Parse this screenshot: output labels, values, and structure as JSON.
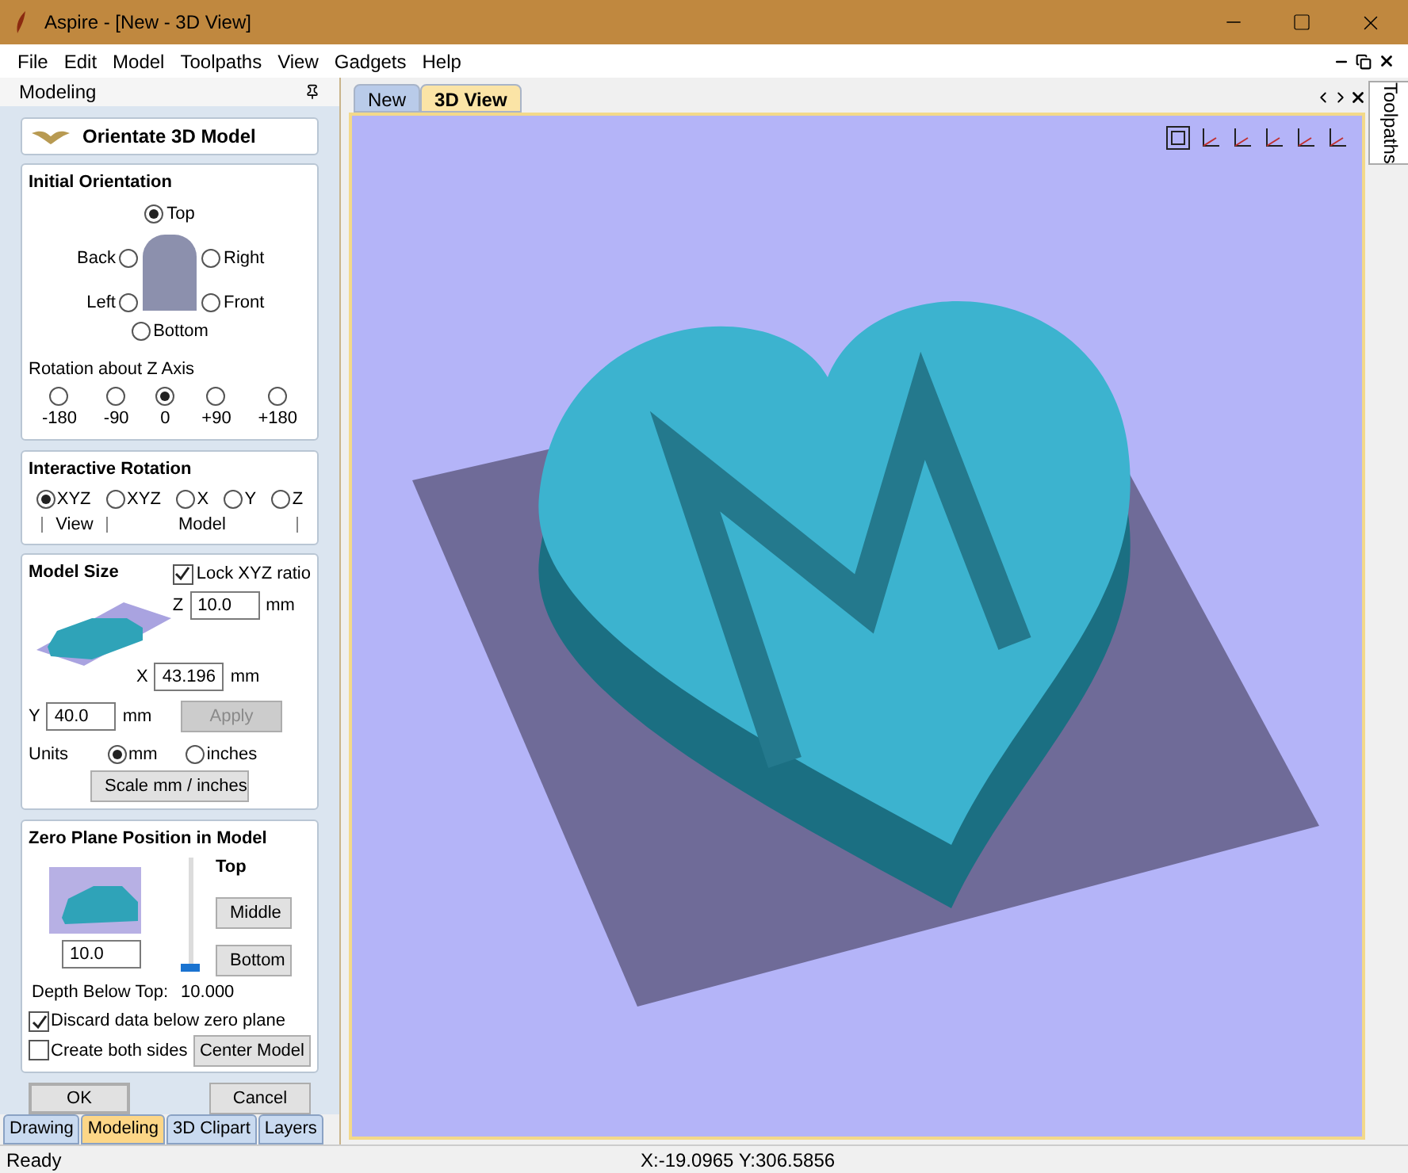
{
  "window": {
    "title": "Aspire - [New - 3D View]"
  },
  "menu": [
    "File",
    "Edit",
    "Model",
    "Toolpaths",
    "View",
    "Gadgets",
    "Help"
  ],
  "panel": {
    "title": "Modeling",
    "header_button": "Orientate 3D Model"
  },
  "initial_orientation": {
    "title": "Initial Orientation",
    "options": [
      {
        "label": "Top",
        "selected": true
      },
      {
        "label": "Back",
        "selected": false
      },
      {
        "label": "Right",
        "selected": false
      },
      {
        "label": "Left",
        "selected": false
      },
      {
        "label": "Front",
        "selected": false
      },
      {
        "label": "Bottom",
        "selected": false
      }
    ],
    "rotation_label": "Rotation about Z Axis",
    "rotation": [
      {
        "label": "-180",
        "selected": false
      },
      {
        "label": "-90",
        "selected": false
      },
      {
        "label": "0",
        "selected": true
      },
      {
        "label": "+90",
        "selected": false
      },
      {
        "label": "+180",
        "selected": false
      }
    ]
  },
  "interactive_rotation": {
    "title": "Interactive Rotation",
    "options": [
      {
        "label": "XYZ",
        "selected": true
      },
      {
        "label": "XYZ",
        "selected": false
      },
      {
        "label": "X",
        "selected": false
      },
      {
        "label": "Y",
        "selected": false
      },
      {
        "label": "Z",
        "selected": false
      }
    ],
    "groups": [
      "View",
      "Model"
    ]
  },
  "model_size": {
    "title": "Model Size",
    "lock": {
      "label": "Lock XYZ ratio",
      "checked": true
    },
    "z": {
      "axis": "Z",
      "value": "10.0",
      "unit": "mm"
    },
    "x": {
      "axis": "X",
      "value": "43.196",
      "unit": "mm"
    },
    "y": {
      "axis": "Y",
      "value": "40.0",
      "unit": "mm"
    },
    "apply": {
      "label": "Apply",
      "disabled": true
    },
    "units_label": "Units",
    "units": [
      {
        "label": "mm",
        "selected": true
      },
      {
        "label": "inches",
        "selected": false
      }
    ],
    "scale_button": "Scale mm / inches"
  },
  "zero_plane": {
    "title": "Zero Plane Position in Model",
    "top_label": "Top",
    "middle_button": "Middle",
    "bottom_button": "Bottom",
    "level": 0,
    "value": "10.0",
    "depth_label": "Depth Below Top:",
    "depth_value": "10.000",
    "checks": [
      {
        "label": "Discard data below zero plane",
        "checked": true
      },
      {
        "label": "Create both sides",
        "checked": false
      }
    ],
    "center_button": "Center Model"
  },
  "buttons": [
    "OK",
    "Cancel"
  ],
  "panel_tabs": [
    {
      "label": "Drawing",
      "selected": false
    },
    {
      "label": "Modeling",
      "selected": true
    },
    {
      "label": "3D Clipart",
      "selected": false
    },
    {
      "label": "Layers",
      "selected": false
    }
  ],
  "doc_tabs": [
    {
      "label": "New",
      "selected": false
    },
    {
      "label": "3D View",
      "selected": true
    }
  ],
  "side_tab": "Toolpaths",
  "status_bar": {
    "text": "Ready",
    "coordinates": "X:-19.0965 Y:306.5856"
  }
}
